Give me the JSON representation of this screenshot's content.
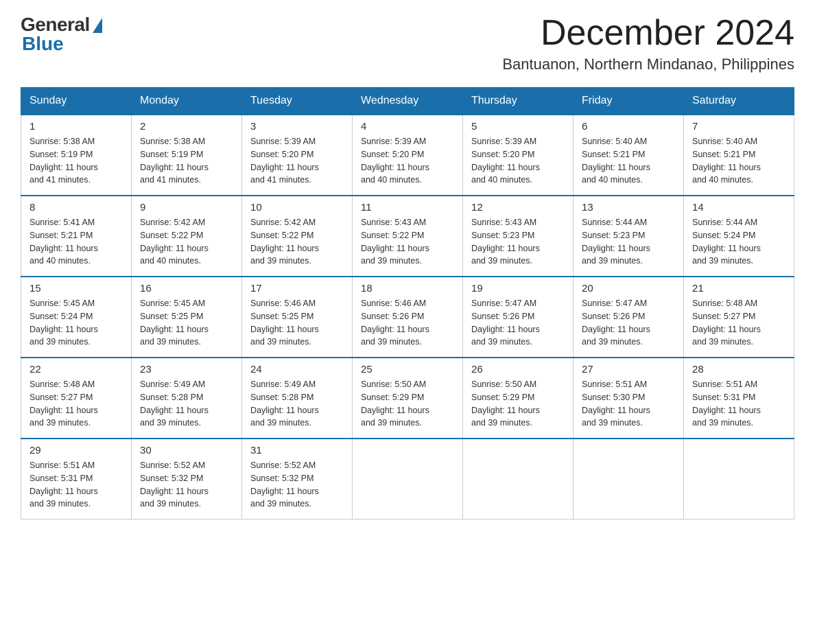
{
  "header": {
    "logo_general": "General",
    "logo_blue": "Blue",
    "month_title": "December 2024",
    "location": "Bantuanon, Northern Mindanao, Philippines"
  },
  "days_of_week": [
    "Sunday",
    "Monday",
    "Tuesday",
    "Wednesday",
    "Thursday",
    "Friday",
    "Saturday"
  ],
  "weeks": [
    [
      {
        "day": "1",
        "sunrise": "5:38 AM",
        "sunset": "5:19 PM",
        "daylight": "11 hours and 41 minutes."
      },
      {
        "day": "2",
        "sunrise": "5:38 AM",
        "sunset": "5:19 PM",
        "daylight": "11 hours and 41 minutes."
      },
      {
        "day": "3",
        "sunrise": "5:39 AM",
        "sunset": "5:20 PM",
        "daylight": "11 hours and 41 minutes."
      },
      {
        "day": "4",
        "sunrise": "5:39 AM",
        "sunset": "5:20 PM",
        "daylight": "11 hours and 40 minutes."
      },
      {
        "day": "5",
        "sunrise": "5:39 AM",
        "sunset": "5:20 PM",
        "daylight": "11 hours and 40 minutes."
      },
      {
        "day": "6",
        "sunrise": "5:40 AM",
        "sunset": "5:21 PM",
        "daylight": "11 hours and 40 minutes."
      },
      {
        "day": "7",
        "sunrise": "5:40 AM",
        "sunset": "5:21 PM",
        "daylight": "11 hours and 40 minutes."
      }
    ],
    [
      {
        "day": "8",
        "sunrise": "5:41 AM",
        "sunset": "5:21 PM",
        "daylight": "11 hours and 40 minutes."
      },
      {
        "day": "9",
        "sunrise": "5:42 AM",
        "sunset": "5:22 PM",
        "daylight": "11 hours and 40 minutes."
      },
      {
        "day": "10",
        "sunrise": "5:42 AM",
        "sunset": "5:22 PM",
        "daylight": "11 hours and 39 minutes."
      },
      {
        "day": "11",
        "sunrise": "5:43 AM",
        "sunset": "5:22 PM",
        "daylight": "11 hours and 39 minutes."
      },
      {
        "day": "12",
        "sunrise": "5:43 AM",
        "sunset": "5:23 PM",
        "daylight": "11 hours and 39 minutes."
      },
      {
        "day": "13",
        "sunrise": "5:44 AM",
        "sunset": "5:23 PM",
        "daylight": "11 hours and 39 minutes."
      },
      {
        "day": "14",
        "sunrise": "5:44 AM",
        "sunset": "5:24 PM",
        "daylight": "11 hours and 39 minutes."
      }
    ],
    [
      {
        "day": "15",
        "sunrise": "5:45 AM",
        "sunset": "5:24 PM",
        "daylight": "11 hours and 39 minutes."
      },
      {
        "day": "16",
        "sunrise": "5:45 AM",
        "sunset": "5:25 PM",
        "daylight": "11 hours and 39 minutes."
      },
      {
        "day": "17",
        "sunrise": "5:46 AM",
        "sunset": "5:25 PM",
        "daylight": "11 hours and 39 minutes."
      },
      {
        "day": "18",
        "sunrise": "5:46 AM",
        "sunset": "5:26 PM",
        "daylight": "11 hours and 39 minutes."
      },
      {
        "day": "19",
        "sunrise": "5:47 AM",
        "sunset": "5:26 PM",
        "daylight": "11 hours and 39 minutes."
      },
      {
        "day": "20",
        "sunrise": "5:47 AM",
        "sunset": "5:26 PM",
        "daylight": "11 hours and 39 minutes."
      },
      {
        "day": "21",
        "sunrise": "5:48 AM",
        "sunset": "5:27 PM",
        "daylight": "11 hours and 39 minutes."
      }
    ],
    [
      {
        "day": "22",
        "sunrise": "5:48 AM",
        "sunset": "5:27 PM",
        "daylight": "11 hours and 39 minutes."
      },
      {
        "day": "23",
        "sunrise": "5:49 AM",
        "sunset": "5:28 PM",
        "daylight": "11 hours and 39 minutes."
      },
      {
        "day": "24",
        "sunrise": "5:49 AM",
        "sunset": "5:28 PM",
        "daylight": "11 hours and 39 minutes."
      },
      {
        "day": "25",
        "sunrise": "5:50 AM",
        "sunset": "5:29 PM",
        "daylight": "11 hours and 39 minutes."
      },
      {
        "day": "26",
        "sunrise": "5:50 AM",
        "sunset": "5:29 PM",
        "daylight": "11 hours and 39 minutes."
      },
      {
        "day": "27",
        "sunrise": "5:51 AM",
        "sunset": "5:30 PM",
        "daylight": "11 hours and 39 minutes."
      },
      {
        "day": "28",
        "sunrise": "5:51 AM",
        "sunset": "5:31 PM",
        "daylight": "11 hours and 39 minutes."
      }
    ],
    [
      {
        "day": "29",
        "sunrise": "5:51 AM",
        "sunset": "5:31 PM",
        "daylight": "11 hours and 39 minutes."
      },
      {
        "day": "30",
        "sunrise": "5:52 AM",
        "sunset": "5:32 PM",
        "daylight": "11 hours and 39 minutes."
      },
      {
        "day": "31",
        "sunrise": "5:52 AM",
        "sunset": "5:32 PM",
        "daylight": "11 hours and 39 minutes."
      },
      null,
      null,
      null,
      null
    ]
  ]
}
